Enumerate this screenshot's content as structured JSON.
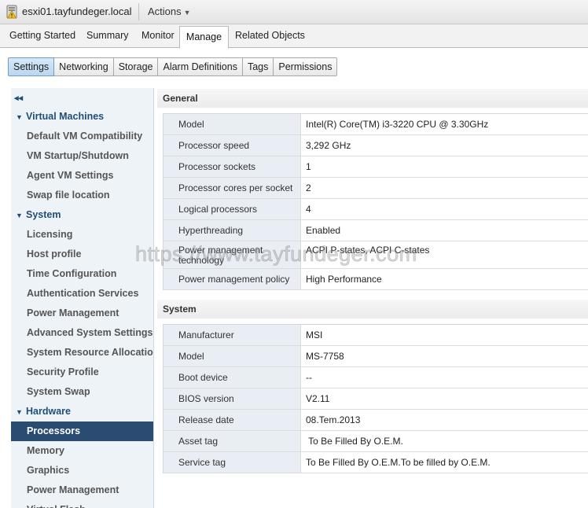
{
  "title_bar": {
    "host_name": "esxi01.tayfundeger.local",
    "actions_label": "Actions"
  },
  "main_tabs": [
    {
      "label": "Getting Started",
      "active": false
    },
    {
      "label": "Summary",
      "active": false
    },
    {
      "label": "Monitor",
      "active": false
    },
    {
      "label": "Manage",
      "active": true
    },
    {
      "label": "Related Objects",
      "active": false
    }
  ],
  "sub_tabs": [
    {
      "label": "Settings",
      "active": true
    },
    {
      "label": "Networking",
      "active": false
    },
    {
      "label": "Storage",
      "active": false
    },
    {
      "label": "Alarm Definitions",
      "active": false
    },
    {
      "label": "Tags",
      "active": false
    },
    {
      "label": "Permissions",
      "active": false
    }
  ],
  "nav": {
    "collapse_glyph": "◂◂",
    "items": [
      {
        "label": "Virtual Machines",
        "group": true
      },
      {
        "label": "Default VM Compatibility"
      },
      {
        "label": "VM Startup/Shutdown"
      },
      {
        "label": "Agent VM Settings"
      },
      {
        "label": "Swap file location"
      },
      {
        "label": "System",
        "group": true
      },
      {
        "label": "Licensing"
      },
      {
        "label": "Host profile"
      },
      {
        "label": "Time Configuration"
      },
      {
        "label": "Authentication Services"
      },
      {
        "label": "Power Management"
      },
      {
        "label": "Advanced System Settings"
      },
      {
        "label": "System Resource Allocation"
      },
      {
        "label": "Security Profile"
      },
      {
        "label": "System Swap"
      },
      {
        "label": "Hardware",
        "group": true
      },
      {
        "label": "Processors",
        "selected": true
      },
      {
        "label": "Memory"
      },
      {
        "label": "Graphics"
      },
      {
        "label": "Power Management"
      },
      {
        "label": "Virtual Flash"
      }
    ]
  },
  "general": {
    "title": "General",
    "rows": [
      {
        "key": "Model",
        "value": "Intel(R) Core(TM) i3-3220 CPU @ 3.30GHz"
      },
      {
        "key": "Processor speed",
        "value": "3,292 GHz"
      },
      {
        "key": "Processor sockets",
        "value": "1"
      },
      {
        "key": "Processor cores per socket",
        "value": "2"
      },
      {
        "key": "Logical processors",
        "value": "4"
      },
      {
        "key": "Hyperthreading",
        "value": "Enabled"
      },
      {
        "key": "Power management technology",
        "value": "ACPI P-states, ACPI C-states",
        "tall": true
      },
      {
        "key": "Power management policy",
        "value": "High Performance"
      }
    ]
  },
  "system": {
    "title": "System",
    "rows": [
      {
        "key": "Manufacturer",
        "value": "MSI"
      },
      {
        "key": "Model",
        "value": "MS-7758"
      },
      {
        "key": "Boot device",
        "value": "--"
      },
      {
        "key": "BIOS version",
        "value": "V2.11"
      },
      {
        "key": "Release date",
        "value": "08.Tem.2013"
      },
      {
        "key": "Asset tag",
        "value": " To Be Filled By O.E.M."
      },
      {
        "key": "Service tag",
        "value": "To Be Filled By O.E.M.To be filled by O.E.M."
      }
    ]
  },
  "watermark": "https://www.tayfundeger.com",
  "colors": {
    "accent_selected": "#2b4c72",
    "nav_group": "#1f4e79",
    "key_cell_bg": "#e8eef4",
    "active_subtab": "#b9d6f0"
  }
}
